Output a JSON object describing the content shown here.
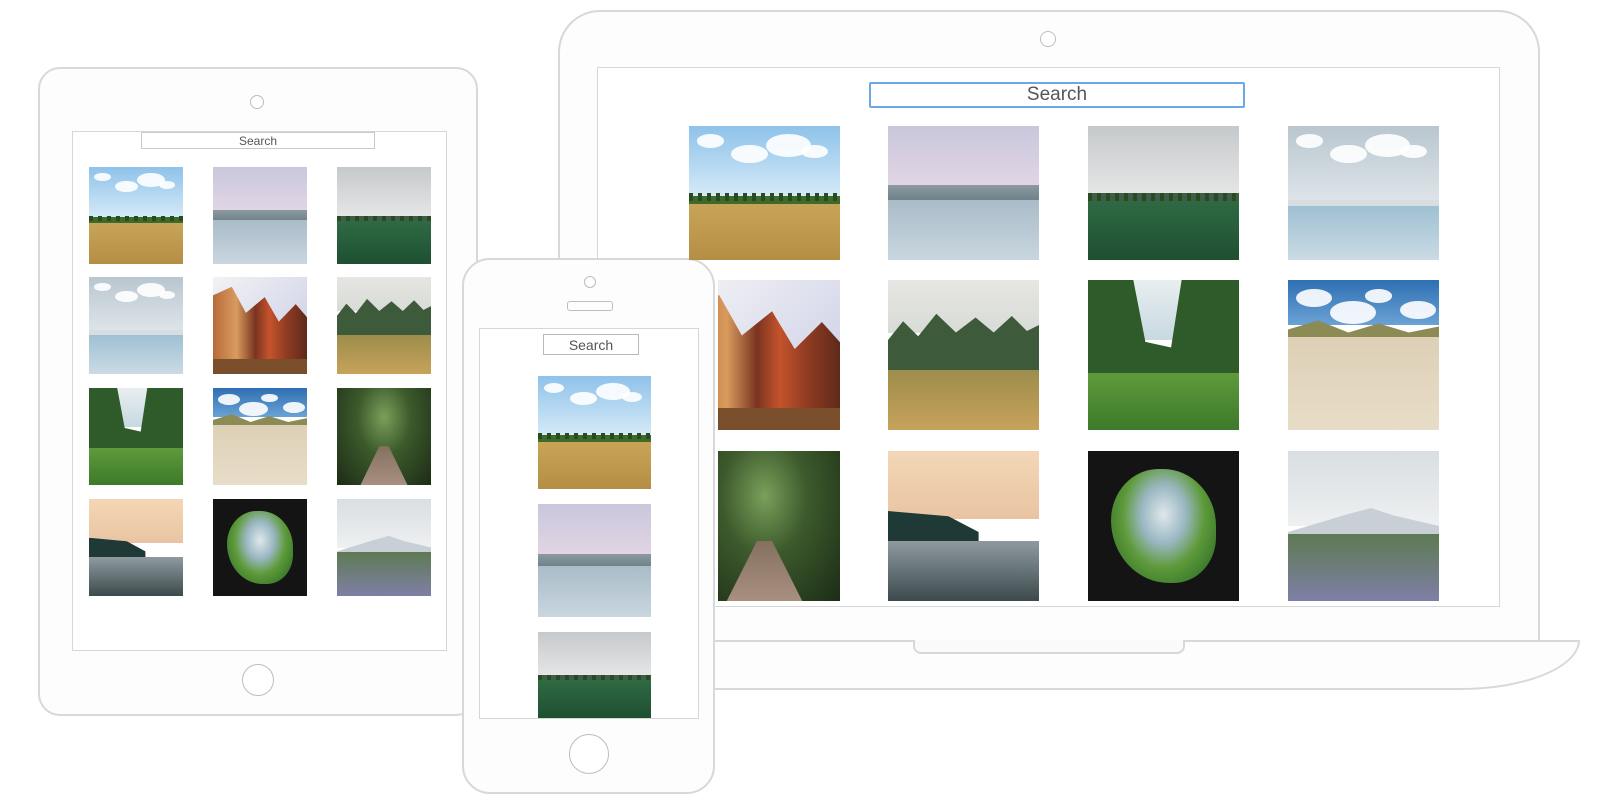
{
  "search": {
    "placeholder": "Search"
  },
  "photos": [
    {
      "scene": "field"
    },
    {
      "scene": "lake"
    },
    {
      "scene": "meadow"
    },
    {
      "scene": "ice"
    },
    {
      "scene": "canyon"
    },
    {
      "scene": "forest"
    },
    {
      "scene": "valley"
    },
    {
      "scene": "dune"
    },
    {
      "scene": "path"
    },
    {
      "scene": "coast"
    },
    {
      "scene": "cave"
    },
    {
      "scene": "lupine"
    }
  ],
  "colors": {
    "search_focus_border": "#6aa8e6",
    "device_outline": "#d8d8d8"
  }
}
